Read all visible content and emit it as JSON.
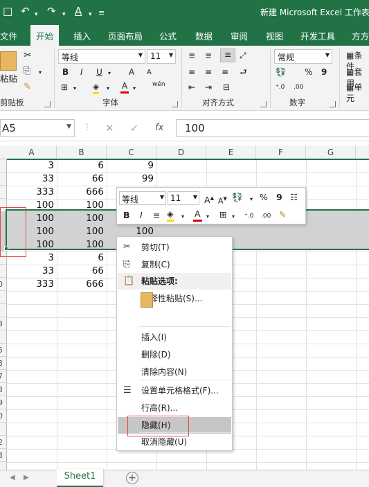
{
  "app": {
    "title": "新建 Microsoft Excel 工作表",
    "quick_access": {
      "save": "□",
      "undo": "↶",
      "redo": "↷",
      "font_color": "A",
      "customize": "≡"
    }
  },
  "ribbon_tabs": [
    "文件",
    "开始",
    "插入",
    "页面布局",
    "公式",
    "数据",
    "审阅",
    "视图",
    "开发工具",
    "方方"
  ],
  "active_tab": "开始",
  "ribbon": {
    "clipboard": {
      "paste_label": "粘贴",
      "group_label": "剪贴板"
    },
    "font": {
      "name": "等线",
      "size": "11",
      "group_label": "字体",
      "bold": "B",
      "italic": "I",
      "underline": "U",
      "grow": "A",
      "shrink": "A",
      "wen": "wén"
    },
    "alignment": {
      "group_label": "对齐方式"
    },
    "number": {
      "format": "常规",
      "group_label": "数字",
      "percent": "%",
      "comma": "9"
    },
    "styles": {
      "items": [
        "条件",
        "套用",
        "单元"
      ]
    }
  },
  "formula_bar": {
    "name_box": "A5",
    "cancel": "✕",
    "confirm": "✓",
    "fx": "fx",
    "value": "100"
  },
  "columns": [
    "A",
    "B",
    "C",
    "D",
    "E",
    "F",
    "G"
  ],
  "rows": [
    {
      "a": "3",
      "b": "6",
      "c": "9"
    },
    {
      "a": "33",
      "b": "66",
      "c": "99"
    },
    {
      "a": "333",
      "b": "666",
      "c": ""
    },
    {
      "a": "100",
      "b": "100",
      "c": ""
    },
    {
      "a": "100",
      "b": "100",
      "c": ""
    },
    {
      "a": "100",
      "b": "100",
      "c": "100"
    },
    {
      "a": "100",
      "b": "100",
      "c": ""
    },
    {
      "a": "3",
      "b": "6",
      "c": ""
    },
    {
      "a": "33",
      "b": "66",
      "c": ""
    },
    {
      "a": "333",
      "b": "666",
      "c": ""
    }
  ],
  "row_numbers": [
    "",
    "",
    "",
    "",
    "",
    "",
    "",
    "",
    "",
    "0",
    "",
    "",
    "3",
    "",
    "5",
    "3",
    "7",
    "3",
    "9",
    "0",
    "",
    "2",
    "3"
  ],
  "mini_toolbar": {
    "font": "等线",
    "size": "11",
    "bold": "B",
    "italic": "I",
    "percent": "%",
    "comma": "9"
  },
  "context_menu": {
    "items": [
      {
        "label": "剪切(T)",
        "icon": "scissors-icon",
        "glyph": "✂"
      },
      {
        "label": "复制(C)",
        "icon": "copy-icon",
        "glyph": "⎘"
      },
      {
        "label": "粘贴选项:",
        "icon": "paste-icon",
        "glyph": "📋"
      },
      {
        "label": "选择性粘贴(S)...",
        "icon": "",
        "glyph": ""
      },
      {
        "label": "插入(I)",
        "icon": "",
        "glyph": ""
      },
      {
        "label": "删除(D)",
        "icon": "",
        "glyph": ""
      },
      {
        "label": "清除内容(N)",
        "icon": "",
        "glyph": ""
      },
      {
        "label": "设置单元格格式(F)...",
        "icon": "format-cells-icon",
        "glyph": "☰"
      },
      {
        "label": "行高(R)...",
        "icon": "",
        "glyph": ""
      },
      {
        "label": "隐藏(H)",
        "icon": "",
        "glyph": ""
      },
      {
        "label": "取消隐藏(U)",
        "icon": "",
        "glyph": ""
      }
    ]
  },
  "sheet_tabs": [
    "Sheet1"
  ],
  "colors": {
    "accent": "#217346",
    "selection": "#d2d2d2",
    "highlight_box": "#e04a4a"
  }
}
